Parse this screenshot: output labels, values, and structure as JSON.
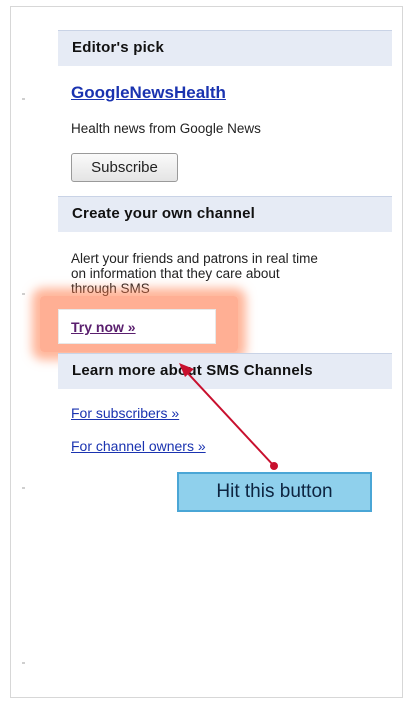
{
  "editors_pick": {
    "header": "Editor's pick",
    "channel_name": "GoogleNewsHealth",
    "description": "Health news from Google News",
    "subscribe_label": "Subscribe"
  },
  "create_channel": {
    "header": "Create your own channel",
    "description_line1": "Alert your friends and patrons in real time",
    "description_line2": "on information that they care about",
    "description_line3": "through SMS",
    "try_now_label": "Try now »"
  },
  "learn_more": {
    "header": "Learn more about SMS Channels",
    "for_subscribers": "For subscribers »",
    "for_channel_owners": "For channel owners »"
  },
  "annotation": {
    "callout_text": "Hit this button",
    "highlight_color": "#ff6e3c",
    "arrow_color": "#c8102e"
  }
}
